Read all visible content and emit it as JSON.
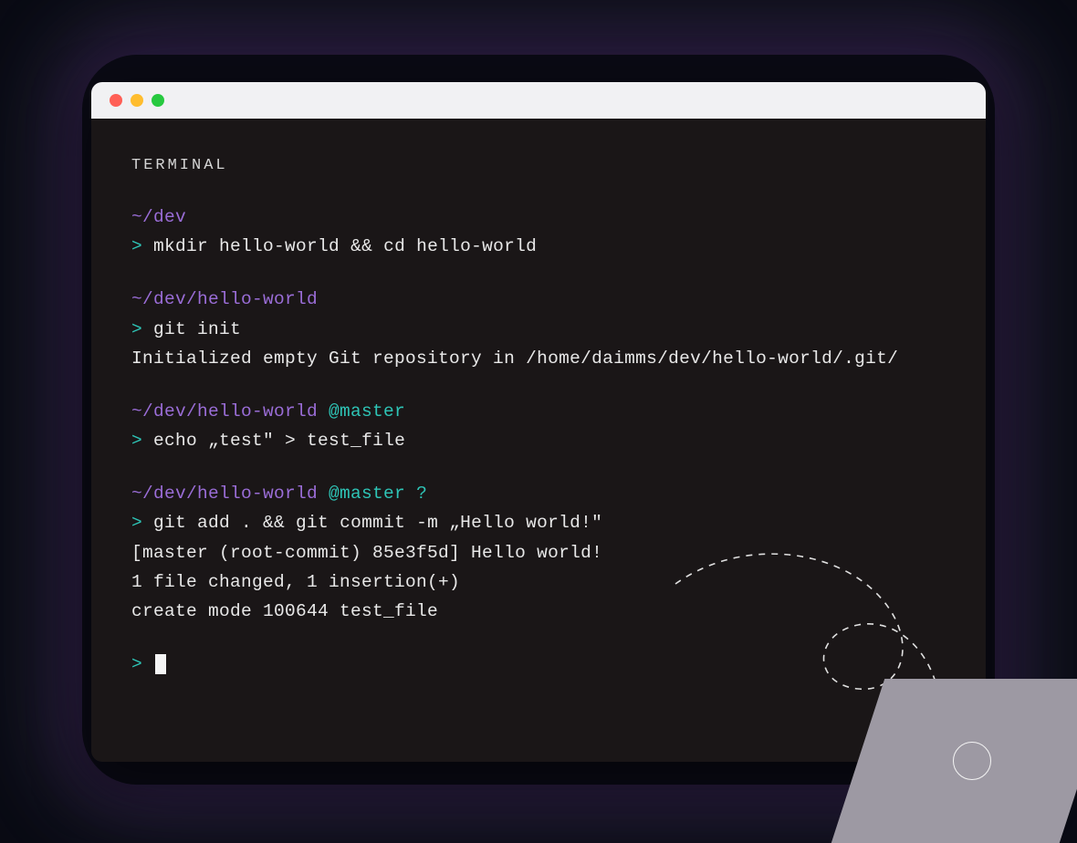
{
  "title": "TERMINAL",
  "blocks": [
    {
      "path": "~/dev",
      "branch": "",
      "command": "mkdir hello-world && cd hello-world",
      "output": []
    },
    {
      "path": "~/dev/hello-world",
      "branch": "",
      "command": "git init",
      "output": [
        "Initialized empty Git repository in /home/daimms/dev/hello-world/.git/"
      ]
    },
    {
      "path": "~/dev/hello-world",
      "branch": " @master",
      "command": "echo „test\" > test_file",
      "output": []
    },
    {
      "path": "~/dev/hello-world",
      "branch": " @master ?",
      "command": "git add . && git commit -m „Hello world!\"",
      "output": [
        "[master (root-commit) 85e3f5d] Hello world!",
        "1 file changed, 1 insertion(+)",
        "create mode 100644 test_file"
      ]
    }
  ],
  "prompt_symbol": ">",
  "colors": {
    "path": "#9a6dd7",
    "branch": "#2ec4b6",
    "prompt": "#2ec4b6",
    "text": "#e8e8e8",
    "bg": "#1a1617"
  }
}
